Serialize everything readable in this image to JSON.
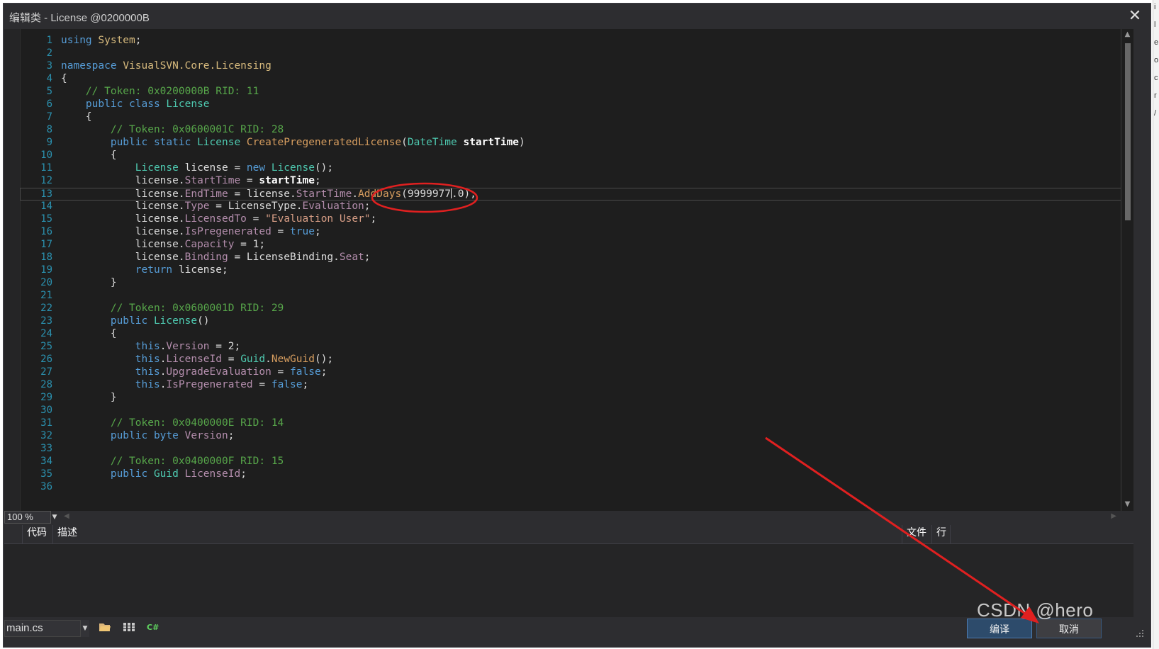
{
  "window": {
    "title": "编辑类 - License @0200000B",
    "close_glyph": "✕"
  },
  "outer_edge_glyphs": [
    "i",
    "l",
    "e",
    "o",
    "c",
    "r",
    "/"
  ],
  "editor": {
    "lines": [
      {
        "n": "1",
        "parts": [
          [
            "kw",
            "using "
          ],
          [
            "nm",
            "System"
          ],
          [
            "p",
            ";"
          ]
        ]
      },
      {
        "n": "2",
        "parts": []
      },
      {
        "n": "3",
        "parts": [
          [
            "kw",
            "namespace "
          ],
          [
            "nm",
            "VisualSVN.Core.Licensing"
          ]
        ]
      },
      {
        "n": "4",
        "parts": [
          [
            "p",
            "{"
          ]
        ]
      },
      {
        "n": "5",
        "parts": [
          [
            "p",
            "    "
          ],
          [
            "cm",
            "// Token: 0x0200000B RID: 11"
          ]
        ]
      },
      {
        "n": "6",
        "parts": [
          [
            "p",
            "    "
          ],
          [
            "kw",
            "public class "
          ],
          [
            "ty",
            "License"
          ]
        ]
      },
      {
        "n": "7",
        "parts": [
          [
            "p",
            "    {"
          ]
        ]
      },
      {
        "n": "8",
        "parts": [
          [
            "p",
            "        "
          ],
          [
            "cm",
            "// Token: 0x0600001C RID: 28"
          ]
        ]
      },
      {
        "n": "9",
        "parts": [
          [
            "p",
            "        "
          ],
          [
            "kw",
            "public static "
          ],
          [
            "ty",
            "License "
          ],
          [
            "mt",
            "CreatePregeneratedLicense"
          ],
          [
            "p",
            "("
          ],
          [
            "ty",
            "DateTime "
          ],
          [
            "bd",
            "startTime"
          ],
          [
            "p",
            ")"
          ]
        ]
      },
      {
        "n": "10",
        "parts": [
          [
            "p",
            "        {"
          ]
        ]
      },
      {
        "n": "11",
        "parts": [
          [
            "p",
            "            "
          ],
          [
            "ty",
            "License "
          ],
          [
            "p",
            "license = "
          ],
          [
            "kw",
            "new "
          ],
          [
            "ty",
            "License"
          ],
          [
            "p",
            "();"
          ]
        ]
      },
      {
        "n": "12",
        "parts": [
          [
            "p",
            "            license."
          ],
          [
            "mb",
            "StartTime"
          ],
          [
            "p",
            " = "
          ],
          [
            "bd",
            "startTime"
          ],
          [
            "p",
            ";"
          ]
        ]
      },
      {
        "n": "13",
        "current": true,
        "parts": [
          [
            "p",
            "            license."
          ],
          [
            "mb",
            "EndTime"
          ],
          [
            "p",
            " = license."
          ],
          [
            "mb",
            "StartTime"
          ],
          [
            "p",
            "."
          ],
          [
            "mt",
            "AddDays"
          ],
          [
            "p",
            "(9999977"
          ],
          [
            "caret",
            ""
          ],
          [
            "p",
            ".0);"
          ]
        ]
      },
      {
        "n": "14",
        "parts": [
          [
            "p",
            "            license."
          ],
          [
            "mb",
            "Type"
          ],
          [
            "p",
            " = LicenseType."
          ],
          [
            "mb",
            "Evaluation"
          ],
          [
            "p",
            ";"
          ]
        ]
      },
      {
        "n": "15",
        "parts": [
          [
            "p",
            "            license."
          ],
          [
            "mb",
            "LicensedTo"
          ],
          [
            "p",
            " = "
          ],
          [
            "st",
            "\"Evaluation User\""
          ],
          [
            "p",
            ";"
          ]
        ]
      },
      {
        "n": "16",
        "parts": [
          [
            "p",
            "            license."
          ],
          [
            "mb",
            "IsPregenerated"
          ],
          [
            "p",
            " = "
          ],
          [
            "kw",
            "true"
          ],
          [
            "p",
            ";"
          ]
        ]
      },
      {
        "n": "17",
        "parts": [
          [
            "p",
            "            license."
          ],
          [
            "mb",
            "Capacity"
          ],
          [
            "p",
            " = 1;"
          ]
        ]
      },
      {
        "n": "18",
        "parts": [
          [
            "p",
            "            license."
          ],
          [
            "mb",
            "Binding"
          ],
          [
            "p",
            " = LicenseBinding."
          ],
          [
            "mb",
            "Seat"
          ],
          [
            "p",
            ";"
          ]
        ]
      },
      {
        "n": "19",
        "parts": [
          [
            "p",
            "            "
          ],
          [
            "kw",
            "return "
          ],
          [
            "p",
            "license;"
          ]
        ]
      },
      {
        "n": "20",
        "parts": [
          [
            "p",
            "        }"
          ]
        ]
      },
      {
        "n": "21",
        "parts": []
      },
      {
        "n": "22",
        "parts": [
          [
            "p",
            "        "
          ],
          [
            "cm",
            "// Token: 0x0600001D RID: 29"
          ]
        ]
      },
      {
        "n": "23",
        "parts": [
          [
            "p",
            "        "
          ],
          [
            "kw",
            "public "
          ],
          [
            "ty",
            "License"
          ],
          [
            "p",
            "()"
          ]
        ]
      },
      {
        "n": "24",
        "parts": [
          [
            "p",
            "        {"
          ]
        ]
      },
      {
        "n": "25",
        "parts": [
          [
            "p",
            "            "
          ],
          [
            "kw",
            "this"
          ],
          [
            "p",
            "."
          ],
          [
            "mb",
            "Version"
          ],
          [
            "p",
            " = 2;"
          ]
        ]
      },
      {
        "n": "26",
        "parts": [
          [
            "p",
            "            "
          ],
          [
            "kw",
            "this"
          ],
          [
            "p",
            "."
          ],
          [
            "mb",
            "LicenseId"
          ],
          [
            "p",
            " = "
          ],
          [
            "ty",
            "Guid"
          ],
          [
            "p",
            "."
          ],
          [
            "mt",
            "NewGuid"
          ],
          [
            "p",
            "();"
          ]
        ]
      },
      {
        "n": "27",
        "parts": [
          [
            "p",
            "            "
          ],
          [
            "kw",
            "this"
          ],
          [
            "p",
            "."
          ],
          [
            "mb",
            "UpgradeEvaluation"
          ],
          [
            "p",
            " = "
          ],
          [
            "kw",
            "false"
          ],
          [
            "p",
            ";"
          ]
        ]
      },
      {
        "n": "28",
        "parts": [
          [
            "p",
            "            "
          ],
          [
            "kw",
            "this"
          ],
          [
            "p",
            "."
          ],
          [
            "mb",
            "IsPregenerated"
          ],
          [
            "p",
            " = "
          ],
          [
            "kw",
            "false"
          ],
          [
            "p",
            ";"
          ]
        ]
      },
      {
        "n": "29",
        "parts": [
          [
            "p",
            "        }"
          ]
        ]
      },
      {
        "n": "30",
        "parts": []
      },
      {
        "n": "31",
        "parts": [
          [
            "p",
            "        "
          ],
          [
            "cm",
            "// Token: 0x0400000E RID: 14"
          ]
        ]
      },
      {
        "n": "32",
        "parts": [
          [
            "p",
            "        "
          ],
          [
            "kw",
            "public byte "
          ],
          [
            "mb",
            "Version"
          ],
          [
            "p",
            ";"
          ]
        ]
      },
      {
        "n": "33",
        "parts": []
      },
      {
        "n": "34",
        "parts": [
          [
            "p",
            "        "
          ],
          [
            "cm",
            "// Token: 0x0400000F RID: 15"
          ]
        ]
      },
      {
        "n": "35",
        "parts": [
          [
            "p",
            "        "
          ],
          [
            "kw",
            "public "
          ],
          [
            "ty",
            "Guid "
          ],
          [
            "mb",
            "LicenseId"
          ],
          [
            "p",
            ";"
          ]
        ]
      },
      {
        "n": "36",
        "parts": []
      }
    ]
  },
  "status": {
    "zoom": "100 %"
  },
  "error_panel": {
    "col_code": "代码",
    "col_desc": "描述",
    "col_file": "文件",
    "col_line": "行"
  },
  "bottom": {
    "file": "main.cs",
    "icons": [
      "open-folder-icon",
      "references-icon",
      "csharp-icon"
    ],
    "compile_label": "编译",
    "cancel_label": "取消"
  },
  "watermark": "CSDN @hero",
  "colors": {
    "annotation": "#e02020",
    "background": "#1e1e1e",
    "accent": "#569cd6"
  }
}
